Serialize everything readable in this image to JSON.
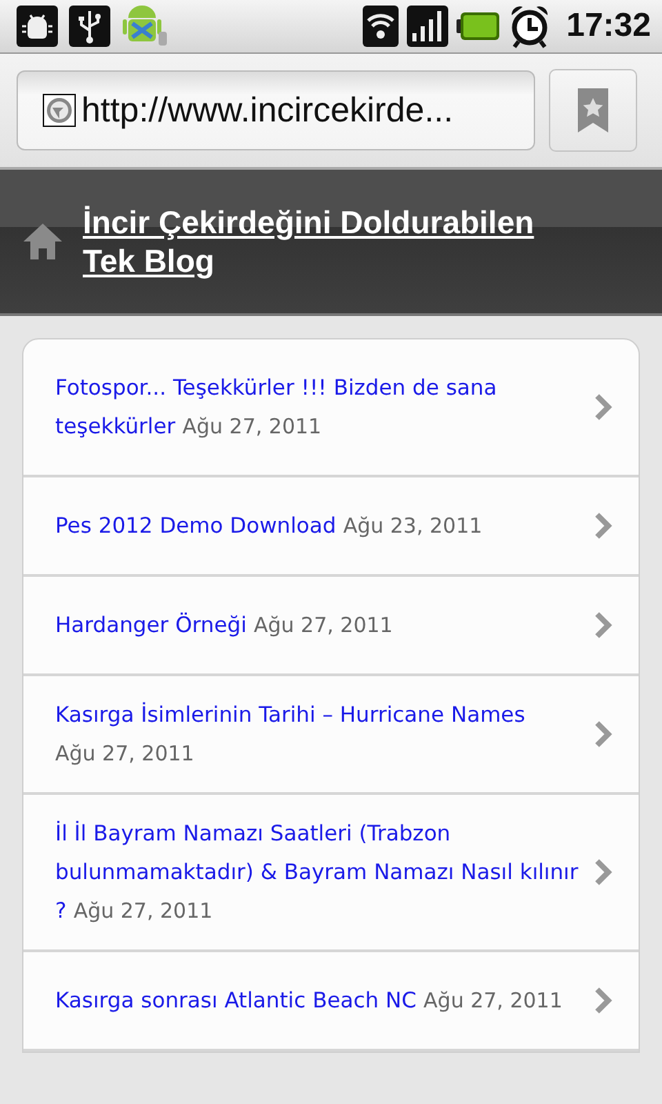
{
  "status_bar": {
    "time": "17:32"
  },
  "address_bar": {
    "url": "http://www.incircekirde..."
  },
  "blog_header": {
    "title": "İncir Çekirdeğini Doldurabilen Tek Blog"
  },
  "posts": [
    {
      "title": "Fotospor... Teşekkürler !!! Bizden de sana teşekkürler",
      "date": "Ağu 27, 2011"
    },
    {
      "title": "Pes 2012 Demo Download",
      "date": "Ağu 23, 2011"
    },
    {
      "title": "Hardanger Örneği",
      "date": "Ağu 27, 2011"
    },
    {
      "title": "Kasırga İsimlerinin Tarihi – Hurricane Names",
      "date": "Ağu 27, 2011"
    },
    {
      "title": "İl İl Bayram Namazı Saatleri (Trabzon bulunmamaktadır) & Bayram Namazı Nasıl kılınır ?",
      "date": "Ağu 27, 2011"
    },
    {
      "title": "Kasırga sonrası Atlantic Beach NC",
      "date": "Ağu 27, 2011"
    }
  ]
}
